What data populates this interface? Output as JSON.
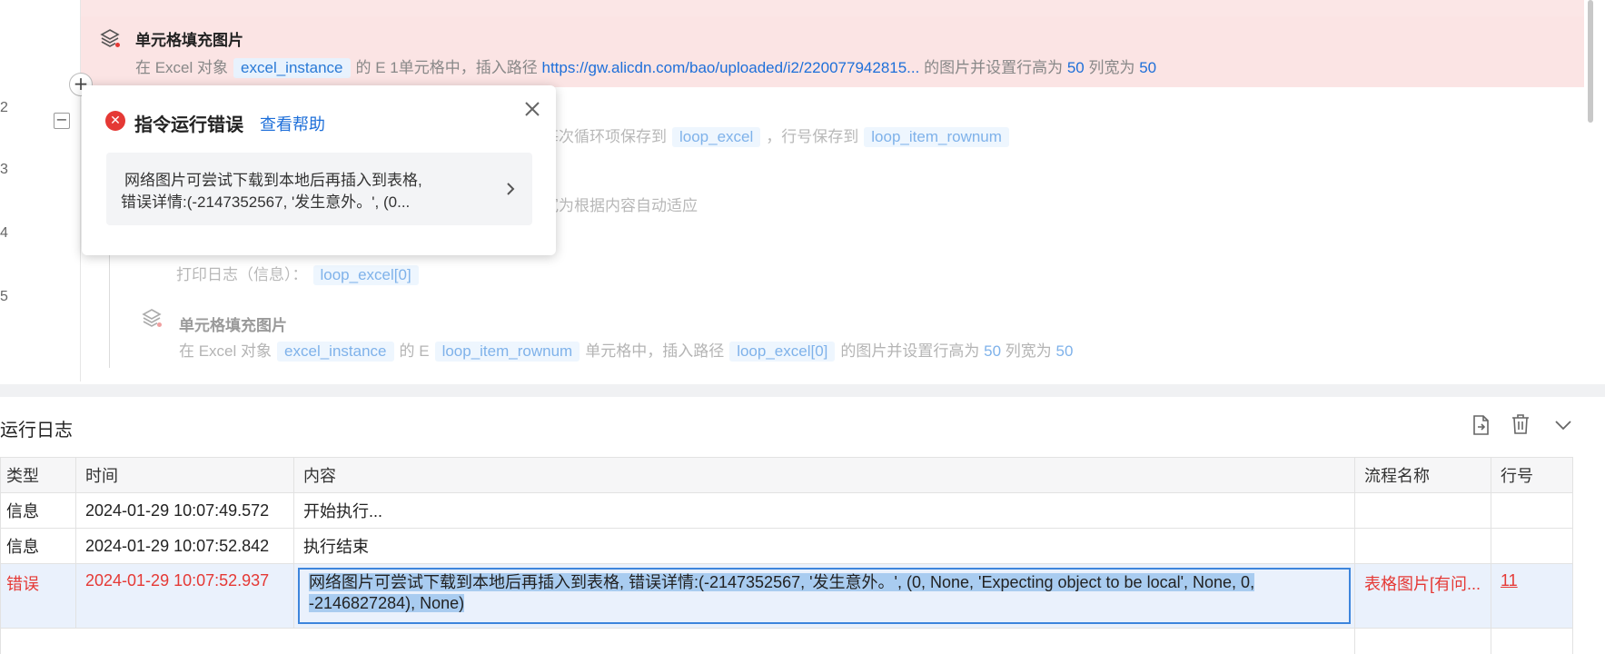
{
  "editor": {
    "line_numbers": [
      "2",
      "3",
      "4",
      "5"
    ],
    "top_partial_text": "在 Excel 对象 excel_instance 的 … 单元格中，插入路径 … 的图片并设置行高为 … 列宽为 …",
    "active_step": {
      "title": "单元格填充图片",
      "desc_prefix": "在 Excel 对象",
      "object": "excel_instance",
      "desc_mid": "的 E 1单元格中，插入路径",
      "url": "https://gw.alicdn.com/bao/uploaded/i2/220077942815...",
      "desc_row": "的图片并设置行高为",
      "row_height": "50",
      "desc_col": "列宽为",
      "col_width": "50"
    },
    "loop_step": {
      "text_a": "每次循环项保存到",
      "loop_var": "loop_excel",
      "text_b": "，行号保存到",
      "row_var": "loop_item_rownum"
    },
    "autofit_text": "宽为根据内容自动适应",
    "log_step": {
      "desc": "打印日志（信息）：",
      "value": "loop_excel[0]"
    },
    "fill_step": {
      "title": "单元格填充图片",
      "desc_prefix": "在 Excel 对象",
      "object": "excel_instance",
      "desc_mid": "的 E",
      "cell": "loop_item_rownum",
      "desc_mid2": "单元格中，插入路径",
      "path": "loop_excel[0]",
      "desc_row": "的图片并设置行高为",
      "row_height": "50",
      "desc_col": "列宽为",
      "col_width": "50"
    }
  },
  "popup": {
    "title": "指令运行错误",
    "help_link": "查看帮助",
    "message_line1": "网络图片可尝试下载到本地后再插入到表格,",
    "message_line2": "错误详情:(-2147352567, '发生意外。', (0..."
  },
  "log_panel": {
    "title": "运行日志",
    "columns": [
      "类型",
      "时间",
      "内容",
      "流程名称",
      "行号"
    ],
    "rows": [
      {
        "type": "信息",
        "time": "2024-01-29 10:07:49.572",
        "content": "开始执行...",
        "flow": "",
        "line": ""
      },
      {
        "type": "信息",
        "time": "2024-01-29 10:07:52.842",
        "content": "执行结束",
        "flow": "",
        "line": ""
      }
    ],
    "error_row": {
      "type": "错误",
      "time": "2024-01-29 10:07:52.937",
      "content_line1": "网络图片可尝试下载到本地后再插入到表格, 错误详情:(-2147352567, '发生意外。', (0, None, 'Expecting object to be local', None, 0,",
      "content_line2": "-2146827284), None)",
      "flow": "表格图片[有问...",
      "line": "11"
    }
  },
  "colors": {
    "error_red": "#e53935",
    "link_blue": "#1e6fd9",
    "active_row_bg": "#fbe4e4",
    "selection_blue": "#3d85dc"
  },
  "icons": [
    "layers-icon",
    "error-circle-icon",
    "close-icon",
    "chevron-right-icon",
    "export-icon",
    "trash-icon",
    "chevron-down-icon",
    "plus-icon",
    "minus-icon"
  ]
}
